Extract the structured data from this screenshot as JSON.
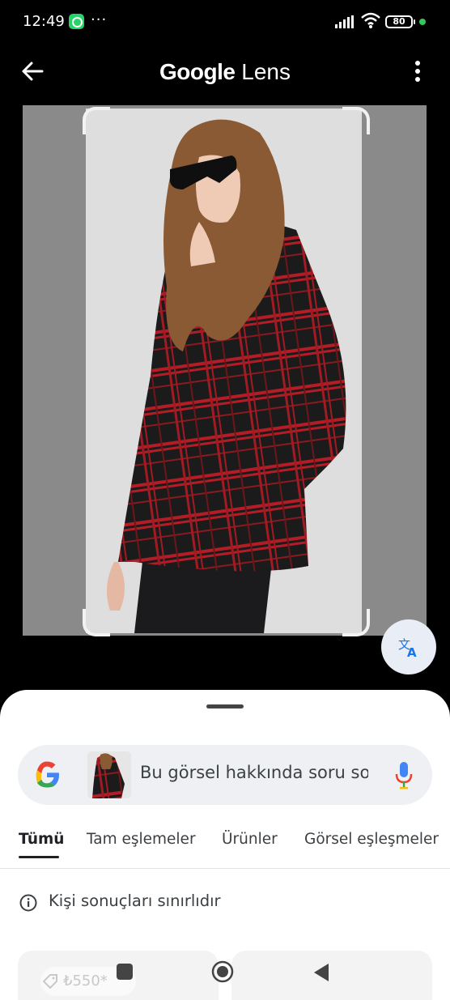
{
  "status_bar": {
    "time": "12:49",
    "more": "···",
    "battery": "80"
  },
  "header": {
    "title_part1": "Google",
    "title_part2": "Lens"
  },
  "colors": {
    "accent_blue": "#1a73e8",
    "google_blue": "#4285F4",
    "google_red": "#EA4335",
    "google_yellow": "#FBBC05",
    "google_green": "#34A853",
    "whatsapp_green": "#25D366"
  },
  "search": {
    "placeholder": "Bu görsel hakkında soru sor"
  },
  "tabs": [
    {
      "label": "Tümü",
      "active": true
    },
    {
      "label": "Tam eşlemeler",
      "active": false
    },
    {
      "label": "Ürünler",
      "active": false
    },
    {
      "label": "Görsel eşleşmeler",
      "active": false
    }
  ],
  "notice": {
    "text": "Kişi sonuçları sınırlıdır"
  },
  "results": [
    {
      "price": "₺550*"
    }
  ],
  "icons": {
    "back": "arrow-left-icon",
    "menu": "more-vert-icon",
    "translate": "translate-icon",
    "google": "google-g-icon",
    "mic": "mic-icon",
    "info": "info-icon",
    "tag": "price-tag-icon"
  }
}
